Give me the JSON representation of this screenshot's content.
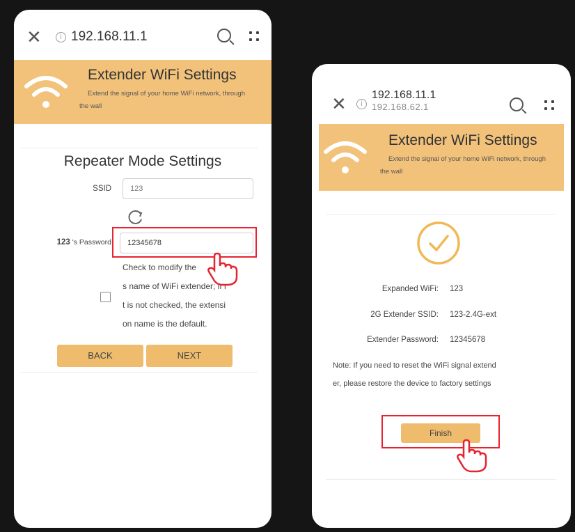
{
  "left_screen": {
    "url": "192.168.11.1",
    "banner": {
      "title": "Extender WiFi Settings",
      "subtitle": "Extend the signal of your home WiFi network, through the wall"
    },
    "panel_title": "Repeater Mode Settings",
    "ssid_label": "SSID",
    "ssid_value": "123",
    "password_label_bold": "123",
    "password_label_rest": " 's Password",
    "password_value": "12345678",
    "modify_note_lines": [
      "Check to modify the",
      "s name of WiFi extender; if i",
      "t is not checked, the extensi",
      "on name is the default."
    ],
    "back_label": "BACK",
    "next_label": "NEXT"
  },
  "right_screen": {
    "url": "192.168.11.1",
    "url_ghost": "192.168.62.1",
    "banner": {
      "title": "Extender WiFi Settings",
      "subtitle": "Extend the signal of your home WiFi network, through the wall"
    },
    "rows": [
      {
        "label": "Expanded WiFi:",
        "value": "123"
      },
      {
        "label": "2G Extender SSID:",
        "value": "123-2.4G-ext"
      },
      {
        "label": "Extender Password:",
        "value": "12345678"
      }
    ],
    "note_lines": [
      "Note: If you need to reset the WiFi signal extend",
      "er, please restore the device to factory settings"
    ],
    "finish_label": "Finish"
  },
  "colors": {
    "banner": "#f2c27b",
    "button": "#efbc6e",
    "highlight_box": "#e52430",
    "check_circle": "#f0b955"
  },
  "icons": [
    "close-icon",
    "info-icon",
    "search-icon",
    "menu-icon",
    "wifi-icon",
    "refresh-icon",
    "check-circle-icon",
    "pointer-hand-icon"
  ]
}
